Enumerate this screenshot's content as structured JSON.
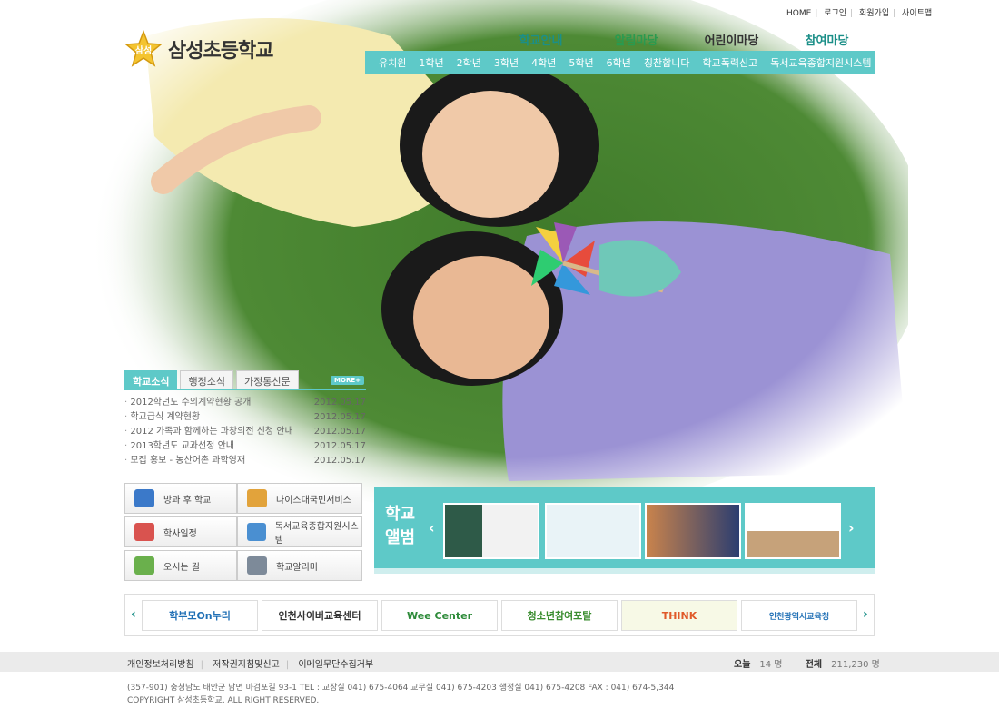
{
  "util_links": [
    "HOME",
    "로그인",
    "회원가입",
    "사이트맵"
  ],
  "logo": {
    "badge": "삼성",
    "name": "삼성초등학교"
  },
  "main_nav": [
    "학교안내",
    "알림마당",
    "어린이마당",
    "참여마당"
  ],
  "sub_nav": [
    "유치원",
    "1학년",
    "2학년",
    "3학년",
    "4학년",
    "5학년",
    "6학년",
    "칭찬합니다",
    "학교폭력신고",
    "독서교육종합지원시스템"
  ],
  "news": {
    "tabs": [
      "학교소식",
      "행정소식",
      "가정통신문"
    ],
    "more": "MORE+",
    "items": [
      {
        "title": "2012학년도 수의계약현황 공개",
        "date": "2012.05.17"
      },
      {
        "title": "학교급식 계약현황",
        "date": "2012.05.17"
      },
      {
        "title": "2012 가족과 함께하는 과창의전 신청 안내",
        "date": "2012.05.17"
      },
      {
        "title": "2013학년도 교과선정 안내",
        "date": "2012.05.17"
      },
      {
        "title": "모집 홍보 - 농산어촌 과학영재",
        "date": "2012.05.17"
      }
    ]
  },
  "quick": [
    {
      "label": "방과 후 학교",
      "icon": "tv-icon",
      "color": "#3b79c9"
    },
    {
      "label": "나이스대국민서비스",
      "icon": "chat-icon",
      "color": "#e2a33b"
    },
    {
      "label": "학사일정",
      "icon": "chart-icon",
      "color": "#d9534f"
    },
    {
      "label": "독서교육종합지원시스템",
      "icon": "books-icon",
      "color": "#4a8fd1"
    },
    {
      "label": "오시는 길",
      "icon": "map-icon",
      "color": "#6ab04c"
    },
    {
      "label": "학교알리미",
      "icon": "phone-icon",
      "color": "#7d8a99"
    }
  ],
  "album": {
    "label_line1": "학교",
    "label_line2": "앨범",
    "prev": "‹",
    "next": "›"
  },
  "banners": [
    {
      "text": "학부모On누리",
      "color": "#1f6fb5"
    },
    {
      "text": "인천사이버교육센터",
      "color": "#333333"
    },
    {
      "text": "Wee Center",
      "color": "#2e8b3a"
    },
    {
      "text": "청소년참여포탈",
      "color": "#3a8d2f"
    },
    {
      "text": "THINK",
      "color": "#e05a2a"
    },
    {
      "text": "인천광역시교육청",
      "color": "#1f6fb5"
    }
  ],
  "banner_prev": "‹",
  "banner_next": "›",
  "footer": {
    "links": [
      "개인정보처리방침",
      "저작권지침및신고",
      "이메일무단수집거부"
    ],
    "today_label": "오늘",
    "today_value": "14 명",
    "total_label": "전체",
    "total_value": "211,230 명",
    "address": "(357-901) 충청남도 태안군 남면 마검포길 93-1  TEL : 교장실 041) 675-4064  교무실 041) 675-4203 행정실 041) 675-4208  FAX : 041) 674-5,344",
    "copyright": "COPYRIGHT 삼성초등학교, ALL RIGHT RESERVED."
  }
}
